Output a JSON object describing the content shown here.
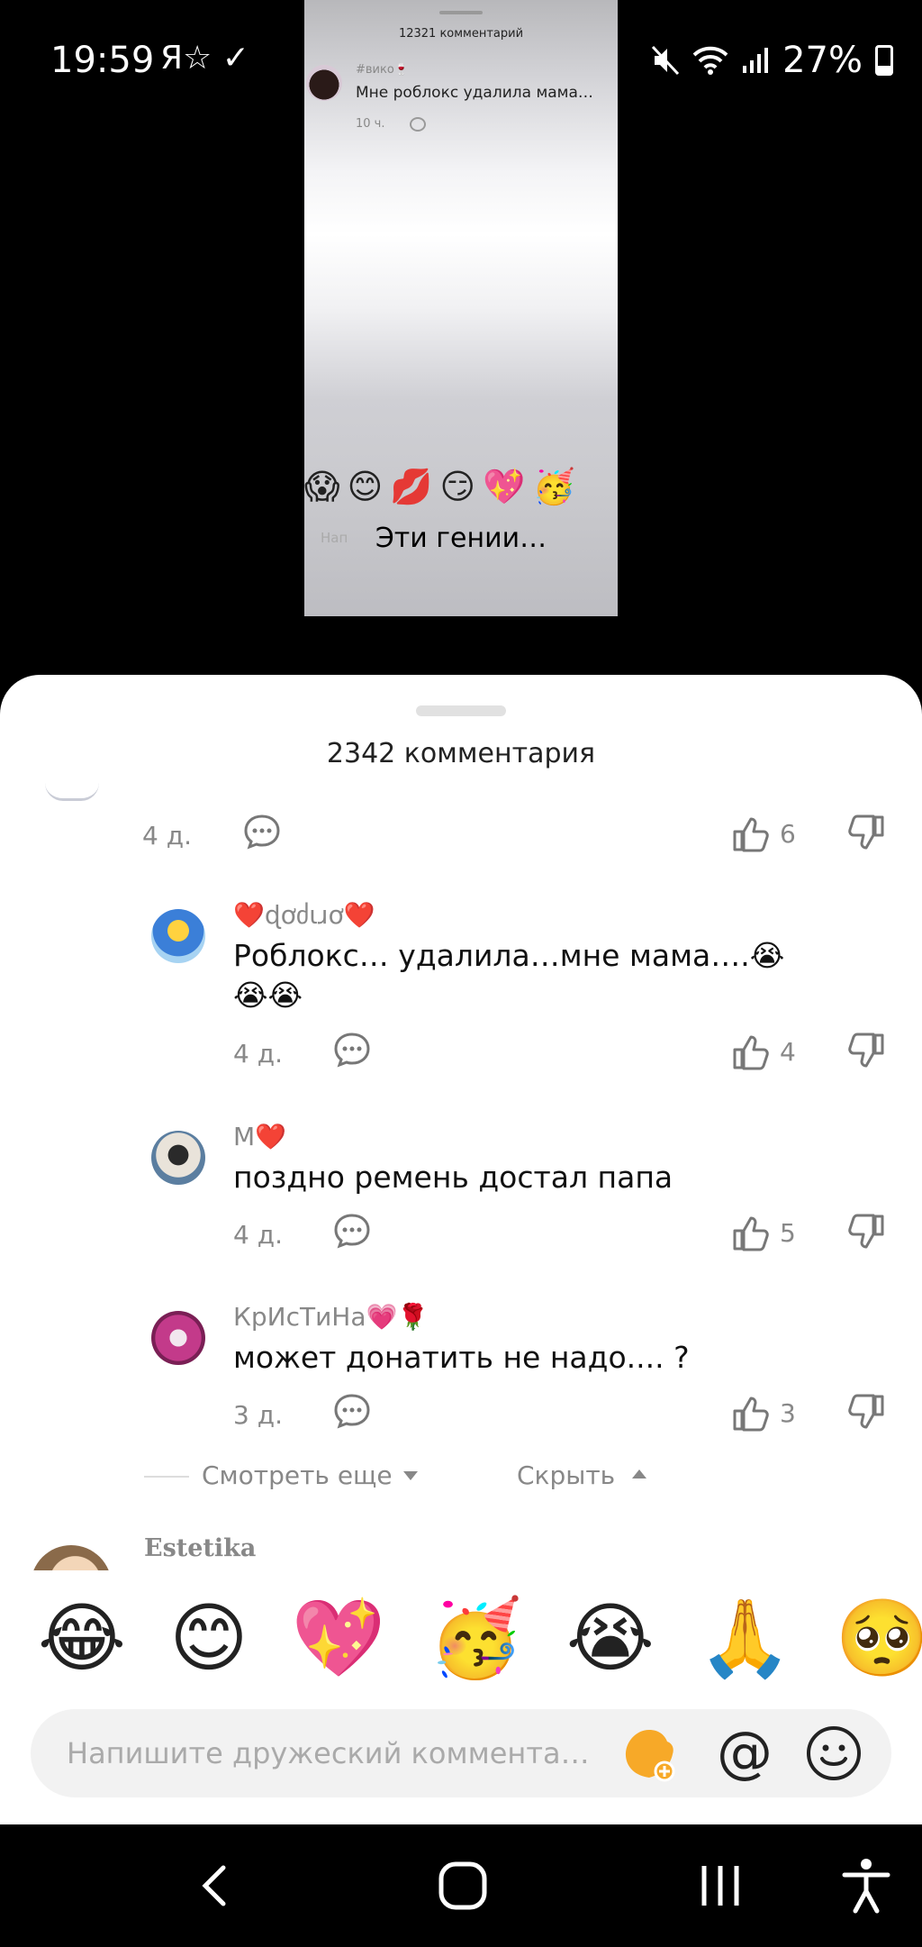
{
  "status_bar": {
    "time": "19:59",
    "left_icons": "Я☆ ✓",
    "battery": "27%"
  },
  "video_preview": {
    "comment_count": "12321 комментарий",
    "username": "#вико🍷",
    "comment_text": "Мне роблокс удалила мама…",
    "time": "10 ч.",
    "emojis": "😱😊💋😏💖🥳",
    "input_placeholder": "Нап",
    "caption": "Эти гении…"
  },
  "sheet": {
    "title": "2342 комментария",
    "first_meta": {
      "time": "4 д.",
      "likes": "6"
    },
    "comments": [
      {
        "username": "❤️ɖơძɩɹơ❤️",
        "text": "Роблокс… удалила…мне мама….😭😭😭",
        "time": "4 д.",
        "likes": "4"
      },
      {
        "username": "М❤️",
        "text": "поздно ремень достал папа",
        "time": "4 д.",
        "likes": "5"
      },
      {
        "username": "КрИсТиНа💗🌹",
        "text": "может донатить не надо.... ?",
        "time": "3 д.",
        "likes": "3"
      }
    ],
    "view_more": "Смотреть еще",
    "hide": "Скрыть",
    "next_username": "Estetika"
  },
  "emoji_bar": [
    "😂",
    "😊",
    "💖",
    "🥳",
    "😭",
    "🙏",
    "🥺",
    "😊"
  ],
  "input": {
    "placeholder": "Напишите дружеский коммента…"
  }
}
